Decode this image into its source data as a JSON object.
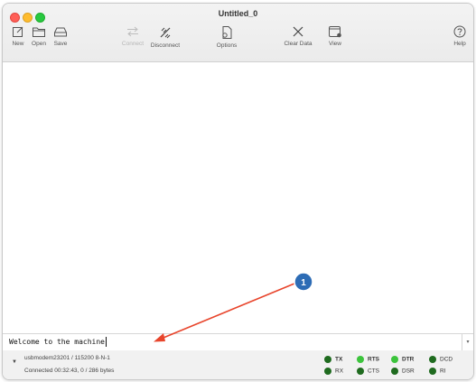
{
  "window": {
    "title": "Untitled_0"
  },
  "toolbar": {
    "new": "New",
    "open": "Open",
    "save": "Save",
    "connect": "Connect",
    "disconnect": "Disconnect",
    "options": "Options",
    "clear": "Clear Data",
    "view": "View",
    "help": "Help"
  },
  "input": {
    "value": "Welcome to the machine"
  },
  "status": {
    "port": "usbmodem23201 / 115200 8-N-1",
    "connection": "Connected 00:32:43, 0 / 286 bytes"
  },
  "signals": [
    {
      "name": "TX",
      "color": "#1f6b1f",
      "bold": true
    },
    {
      "name": "RX",
      "color": "#1f6b1f",
      "bold": false
    },
    {
      "name": "RTS",
      "color": "#3cc43c",
      "bold": true
    },
    {
      "name": "CTS",
      "color": "#1f6b1f",
      "bold": false
    },
    {
      "name": "DTR",
      "color": "#3cc43c",
      "bold": true
    },
    {
      "name": "DSR",
      "color": "#1f6b1f",
      "bold": false
    },
    {
      "name": "DCD",
      "color": "#1f6b1f",
      "bold": false
    },
    {
      "name": "RI",
      "color": "#1f6b1f",
      "bold": false
    }
  ],
  "annotation": {
    "number": "1",
    "color": "#2d6cb5",
    "arrow_color": "#e8452c"
  }
}
